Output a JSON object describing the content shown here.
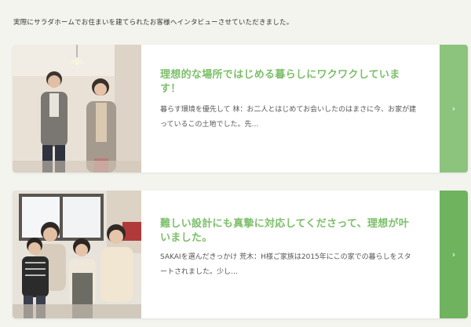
{
  "intro": "実際にサラダホームでお住まいを建てられたお客様へインタビューさせていただきました。",
  "interviews": [
    {
      "title": "理想的な場所ではじめる暮らしにワクワクしています！",
      "excerpt": "暮らす環境を優先して 林：お二人とはじめてお会いしたのはまさに今、お家が建っているこの土地でした。先…",
      "arrow": "›"
    },
    {
      "title": "難しい設計にも真摯に対応してくださって、理想が叶いました。",
      "excerpt": "SAKAIを選んだきっかけ 荒木：H様ご家族は2015年にこの家での暮らしをスタートされました。少し…",
      "arrow": "›"
    }
  ],
  "colors": {
    "accent_title": "#7cbf6a",
    "button_1": "#8cc47e",
    "button_2": "#6fb35f",
    "page_bg": "#f4f4ef"
  }
}
